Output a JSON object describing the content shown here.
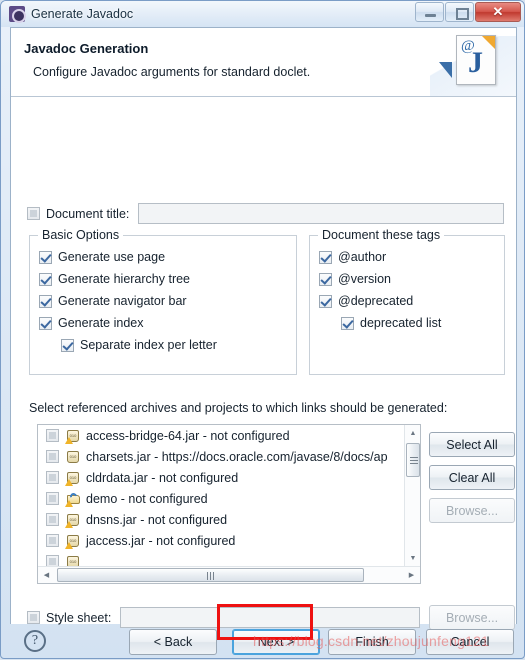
{
  "window": {
    "title": "Generate Javadoc",
    "icon": "javadoc-wizard-icon",
    "caption": {
      "minimize": "minimize-icon",
      "maximize": "maximize-icon",
      "close": "✕"
    }
  },
  "header": {
    "title": "Javadoc Generation",
    "description": "Configure Javadoc arguments for standard doclet.",
    "art_icon": "javadoc-page-icon",
    "art_at": "@",
    "art_letter": "J"
  },
  "document_title": {
    "label": "Document title:",
    "checked": false,
    "value": "",
    "enabled": false
  },
  "basic_options": {
    "title": "Basic Options",
    "items": [
      {
        "label": "Generate use page",
        "checked": true,
        "indent": false
      },
      {
        "label": "Generate hierarchy tree",
        "checked": true,
        "indent": false
      },
      {
        "label": "Generate navigator bar",
        "checked": true,
        "indent": false
      },
      {
        "label": "Generate index",
        "checked": true,
        "indent": false
      },
      {
        "label": "Separate index per letter",
        "checked": true,
        "indent": true
      }
    ]
  },
  "document_tags": {
    "title": "Document these tags",
    "items": [
      {
        "label": "@author",
        "checked": true,
        "indent": false
      },
      {
        "label": "@version",
        "checked": true,
        "indent": false
      },
      {
        "label": "@deprecated",
        "checked": true,
        "indent": false
      },
      {
        "label": "deprecated list",
        "checked": true,
        "indent": true
      }
    ]
  },
  "references": {
    "label": "Select referenced archives and projects to which links should be generated:",
    "items": [
      {
        "label": "access-bridge-64.jar - not configured",
        "checked": false,
        "icon": "jar-warning-icon"
      },
      {
        "label": "charsets.jar - https://docs.oracle.com/javase/8/docs/ap",
        "checked": false,
        "icon": "jar-icon"
      },
      {
        "label": "cldrdata.jar - not configured",
        "checked": false,
        "icon": "jar-warning-icon"
      },
      {
        "label": "demo - not configured",
        "checked": false,
        "icon": "project-folder-icon"
      },
      {
        "label": "dnsns.jar - not configured",
        "checked": false,
        "icon": "jar-warning-icon"
      },
      {
        "label": "jaccess.jar - not configured",
        "checked": false,
        "icon": "jar-warning-icon"
      }
    ],
    "buttons": {
      "select_all": "Select All",
      "clear_all": "Clear All",
      "browse": "Browse..."
    }
  },
  "style_sheet": {
    "label": "Style sheet:",
    "checked": false,
    "value": "",
    "browse": "Browse..."
  },
  "footer": {
    "help": "?",
    "back": "< Back",
    "next": "Next >",
    "finish": "Finish",
    "cancel": "Cancel"
  },
  "annotation": {
    "highlight_target": "Next >",
    "highlight_color": "#ee1111"
  },
  "watermark": "https://blog.csdn.net/zhoujunfeng121"
}
